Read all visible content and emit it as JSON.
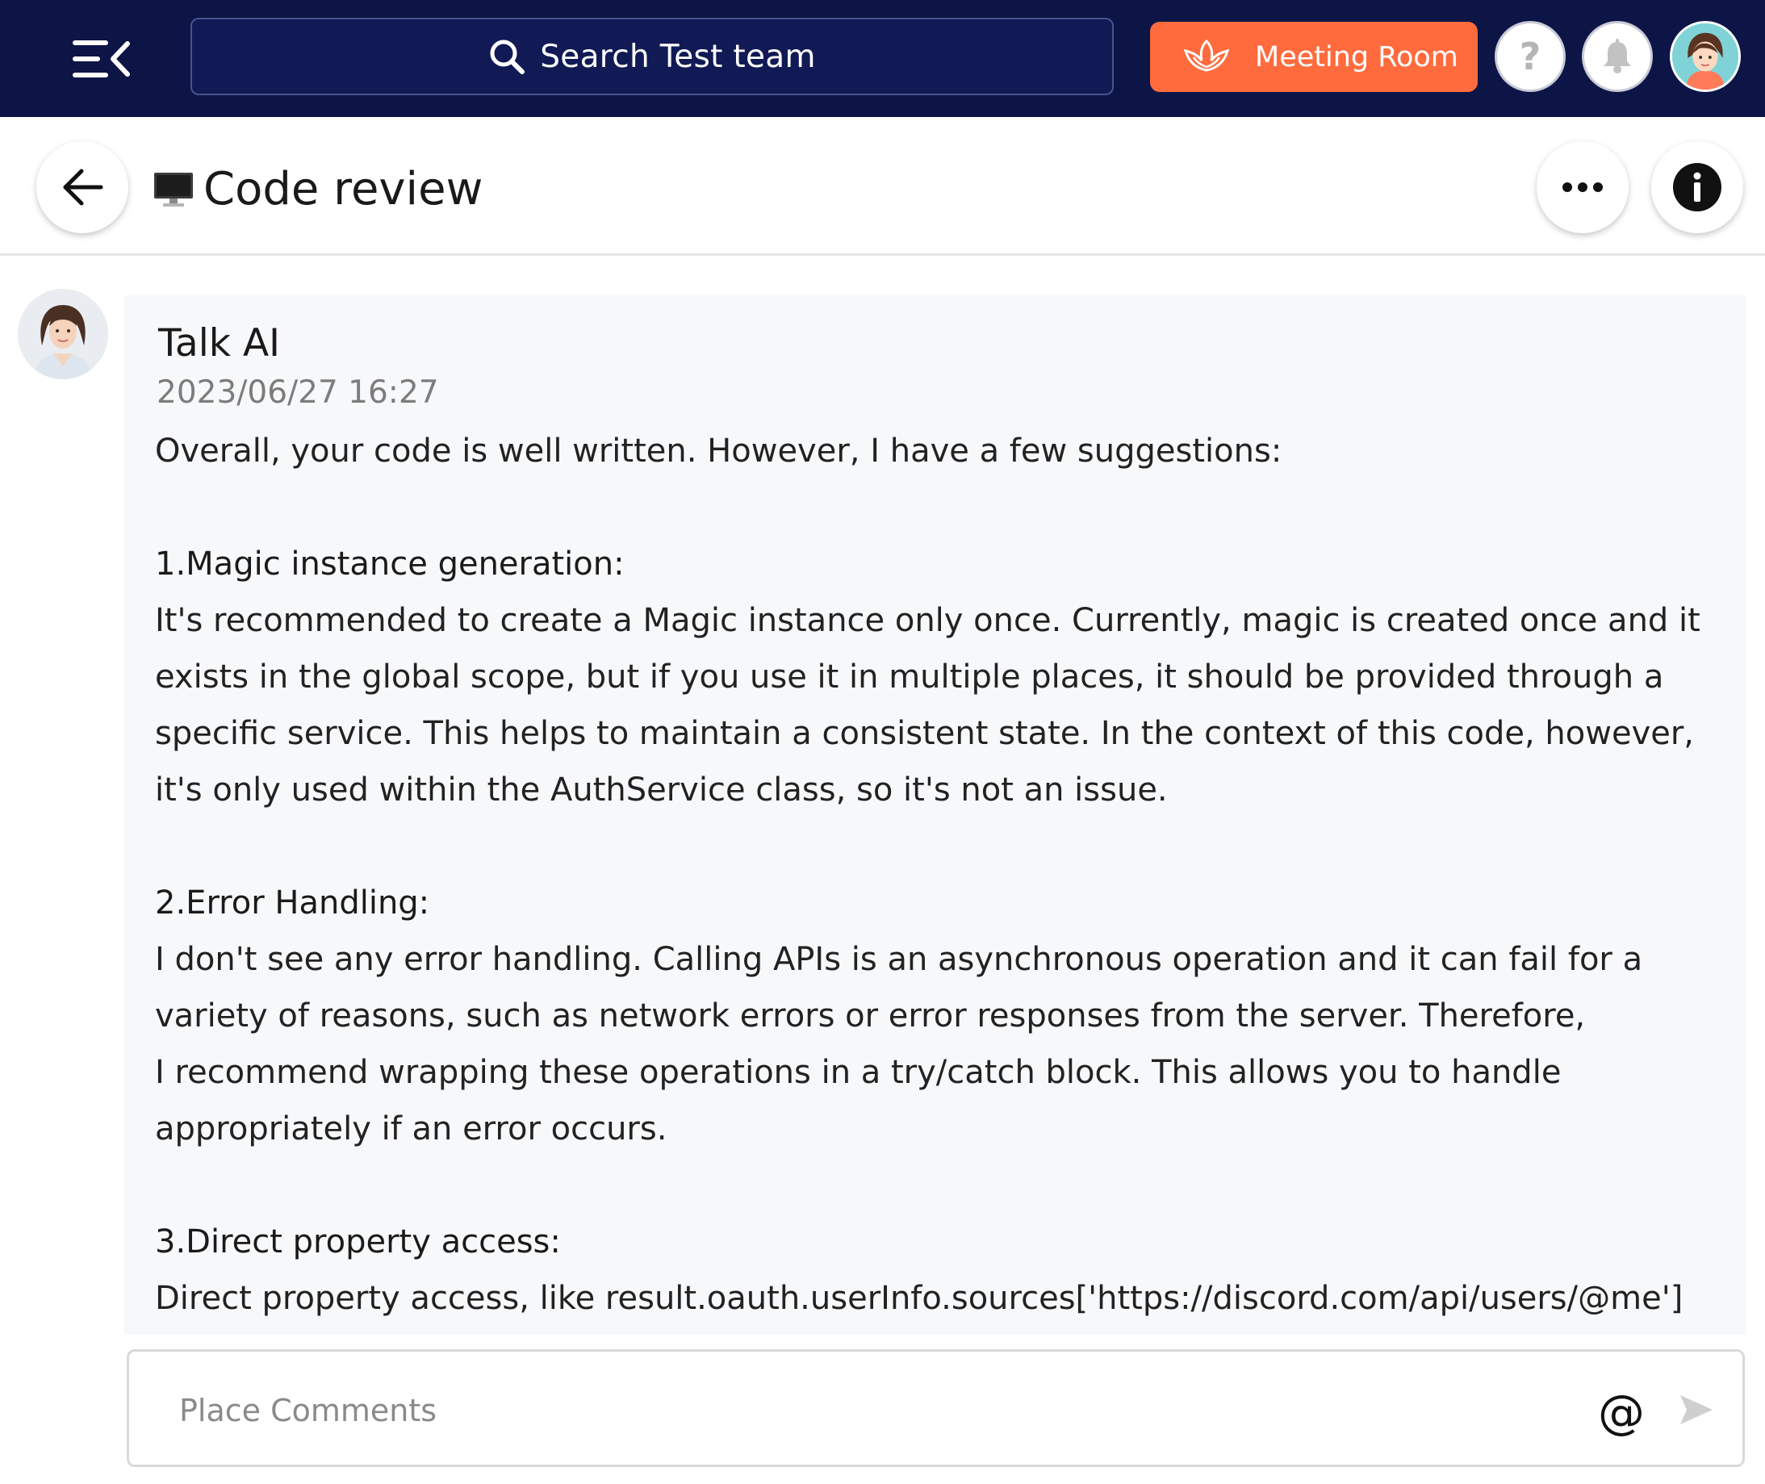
{
  "header": {
    "search_placeholder": "Search Test team",
    "meeting_room_label": "Meeting Room",
    "help_label": "?",
    "colors": {
      "bar": "#0d1446",
      "accent": "#ff6b3d"
    }
  },
  "titlebar": {
    "title": "Code review",
    "title_icon": "desktop-computer-icon"
  },
  "message": {
    "author": "Talk AI",
    "timestamp": "2023/06/27 16:27",
    "intro": "Overall, your code is well written. However, I have a few suggestions:",
    "sections": [
      {
        "heading": "1.Magic instance generation:",
        "lines": [
          "It's recommended to create a Magic instance only once. Currently, magic is created once and it",
          "exists in the global scope, but if you use it in multiple places, it should be provided through a",
          "specific service. This helps to maintain a consistent state. In the context of this code, however,",
          "it's only used within the AuthService class, so it's not an issue."
        ]
      },
      {
        "heading": "2.Error Handling:",
        "lines": [
          "I don't see any error handling. Calling APIs is an asynchronous operation and it can fail for a",
          "variety of reasons, such as network errors or error responses from the server. Therefore,",
          "I recommend wrapping these operations in a try/catch block. This allows you to handle",
          "appropriately if an error occurs."
        ]
      },
      {
        "heading": "3.Direct property access:",
        "lines": [
          "Direct property access, like result.oauth.userInfo.sources['https://discord.com/api/users/@me']"
        ]
      }
    ]
  },
  "composer": {
    "placeholder": "Place Comments",
    "mention_label": "@"
  }
}
